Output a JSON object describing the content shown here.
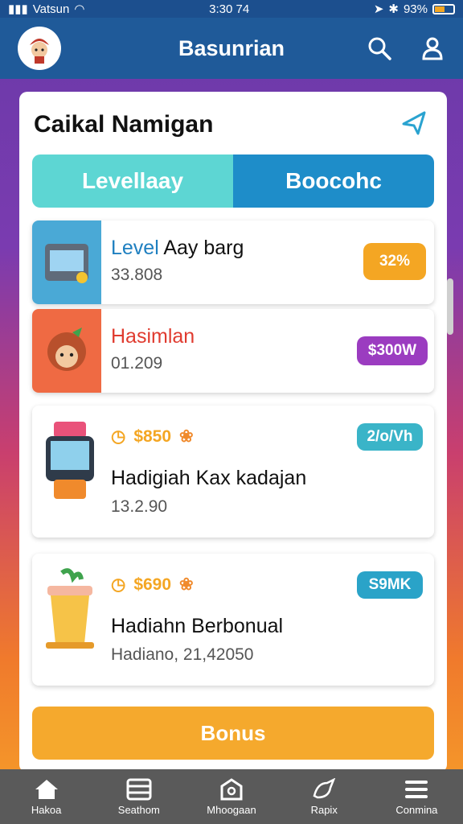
{
  "status": {
    "carrier": "Vatsun",
    "time": "3:30 74",
    "battery": "93%"
  },
  "appbar": {
    "title": "Basunrian",
    "avatar_icon": "character-avatar",
    "search_icon": "search-icon",
    "profile_icon": "user-icon"
  },
  "panel": {
    "title": "Caikal Namigan"
  },
  "tabs": [
    {
      "label": "Levellaay"
    },
    {
      "label": "Boocohc"
    }
  ],
  "cards": [
    {
      "name_prefix": "Level",
      "name_rest": " Aay barg",
      "value": "33.808",
      "badge": "32%",
      "badge_color": "#f4a623"
    },
    {
      "name": "Hasimlan",
      "value": "01.209",
      "badge": "$300W",
      "badge_color": "#9b3cc0"
    },
    {
      "meta": "$850",
      "name": "Hadigiah Kax kadajan",
      "value": "13.2.90",
      "badge": "2/o/Vh",
      "badge_color": "#3ab4c8"
    },
    {
      "meta": "$690",
      "name": "Hadiahn Berbonual",
      "value": "Hadiano, 21,42050",
      "badge": "S9MK",
      "badge_color": "#2aa3c8"
    }
  ],
  "bonus_button": "Bonus",
  "nav": [
    {
      "label": "Hakoa",
      "icon": "home-icon"
    },
    {
      "label": "Seathom",
      "icon": "grid-icon"
    },
    {
      "label": "Mhoogaan",
      "icon": "bag-icon"
    },
    {
      "label": "Rapix",
      "icon": "bird-icon"
    },
    {
      "label": "Conmina",
      "icon": "menu-icon"
    }
  ]
}
